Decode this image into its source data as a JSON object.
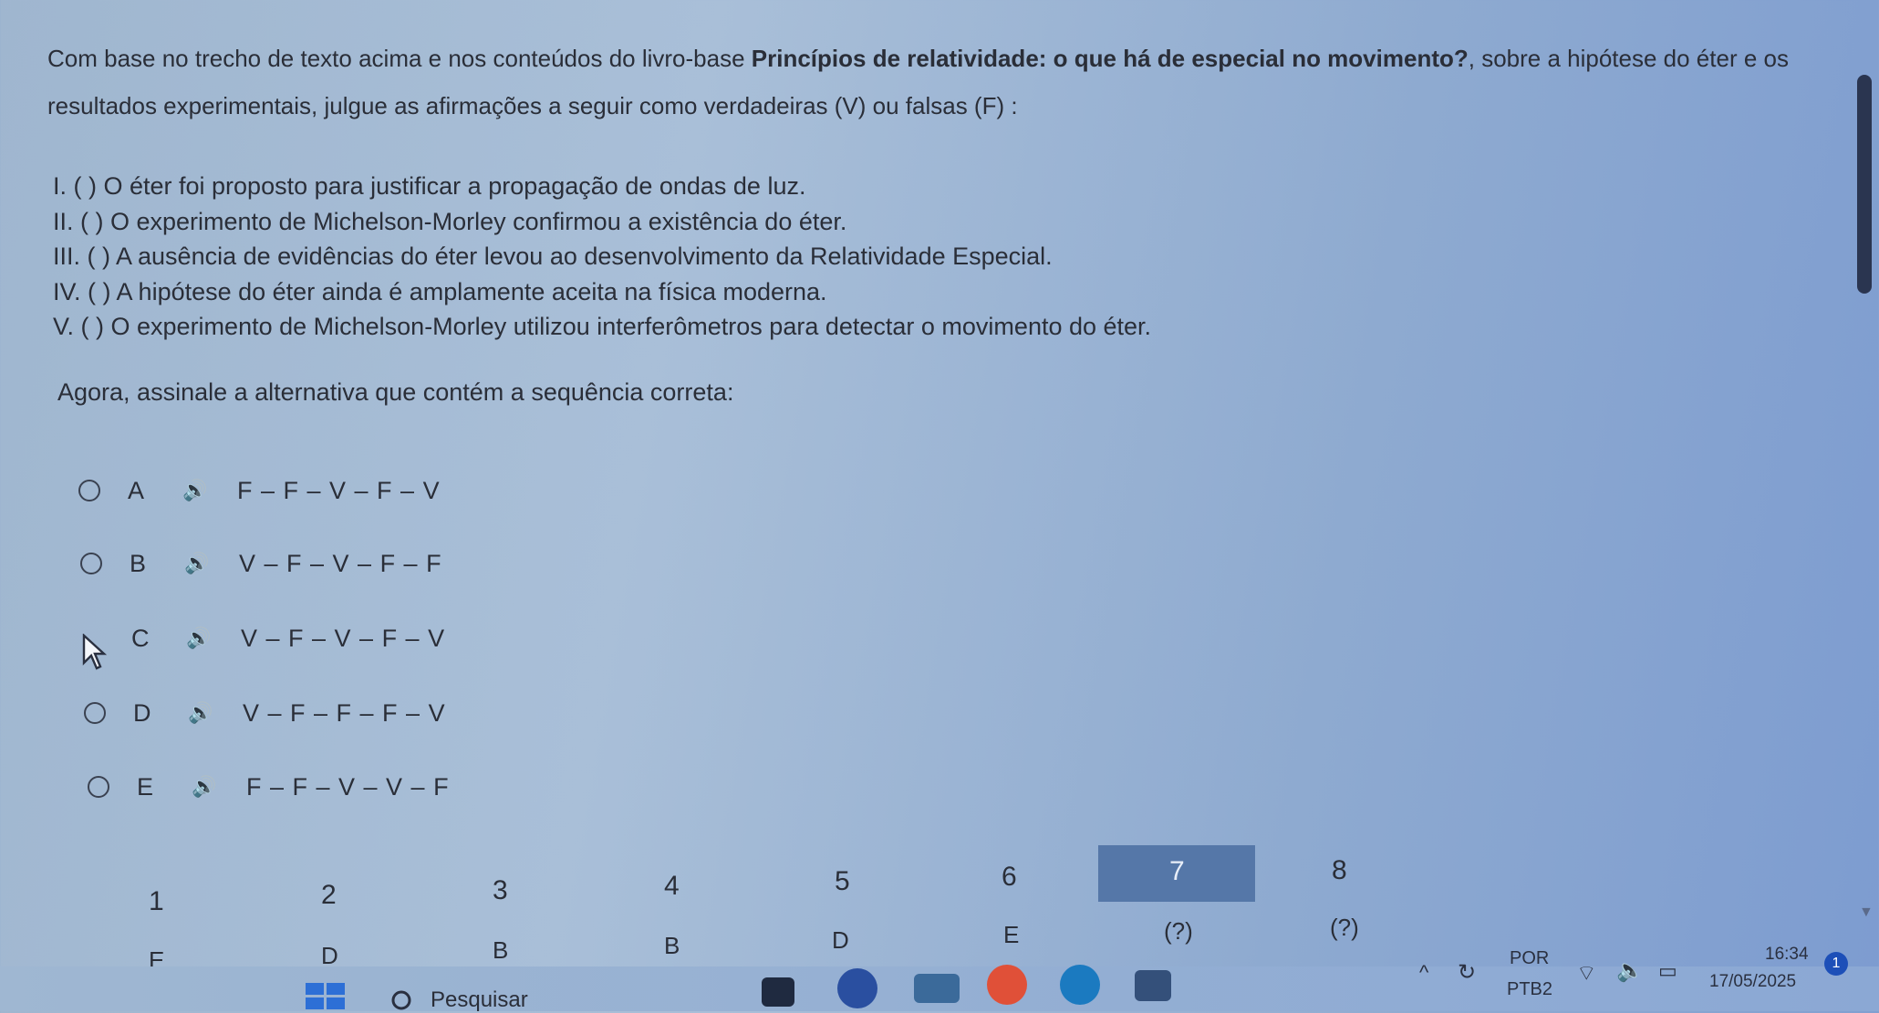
{
  "question": {
    "intro_pre": "Com base no trecho de texto acima e nos conteúdos do livro-base ",
    "intro_bold": "Princípios de relatividade: o que há de especial no movimento?",
    "intro_post": ", sobre a hipótese do éter e os resultados experimentais, julgue as afirmações a seguir como verdadeiras (V) ou falsas (F) :",
    "statements": [
      "I. ( ) O éter foi proposto para justificar a propagação de ondas de luz.",
      "II. ( ) O experimento de Michelson-Morley confirmou a existência do éter.",
      "III. ( ) A ausência de evidências do éter levou ao desenvolvimento da Relatividade Especial.",
      "IV. ( ) A hipótese do éter ainda é amplamente aceita na física moderna.",
      "V. ( ) O experimento de Michelson-Morley utilizou interferômetros para detectar o movimento do éter."
    ],
    "prompt": "Agora, assinale a alternativa que contém a sequência correta:"
  },
  "options": [
    {
      "letter": "A",
      "sequence": "F – F – V – F – V"
    },
    {
      "letter": "B",
      "sequence": "V – F – V – F – F"
    },
    {
      "letter": "C",
      "sequence": "V – F – V – F – V"
    },
    {
      "letter": "D",
      "sequence": "V – F – F – F – V"
    },
    {
      "letter": "E",
      "sequence": "F – F – V – V – F"
    }
  ],
  "navigation": {
    "questions": [
      {
        "number": "1",
        "answer": "E"
      },
      {
        "number": "2",
        "answer": "D"
      },
      {
        "number": "3",
        "answer": "B"
      },
      {
        "number": "4",
        "answer": "B"
      },
      {
        "number": "5",
        "answer": "D"
      },
      {
        "number": "6",
        "answer": "E"
      },
      {
        "number": "7",
        "answer": "(?)"
      },
      {
        "number": "8",
        "answer": "(?)"
      }
    ],
    "active": "7"
  },
  "taskbar": {
    "search_label": "Pesquisar",
    "lang_top": "POR",
    "lang_bottom": "PTB2",
    "time": "16:34",
    "date": "17/05/2025",
    "notification_count": "1"
  },
  "colors": {
    "active_tab": "#5577a8"
  }
}
